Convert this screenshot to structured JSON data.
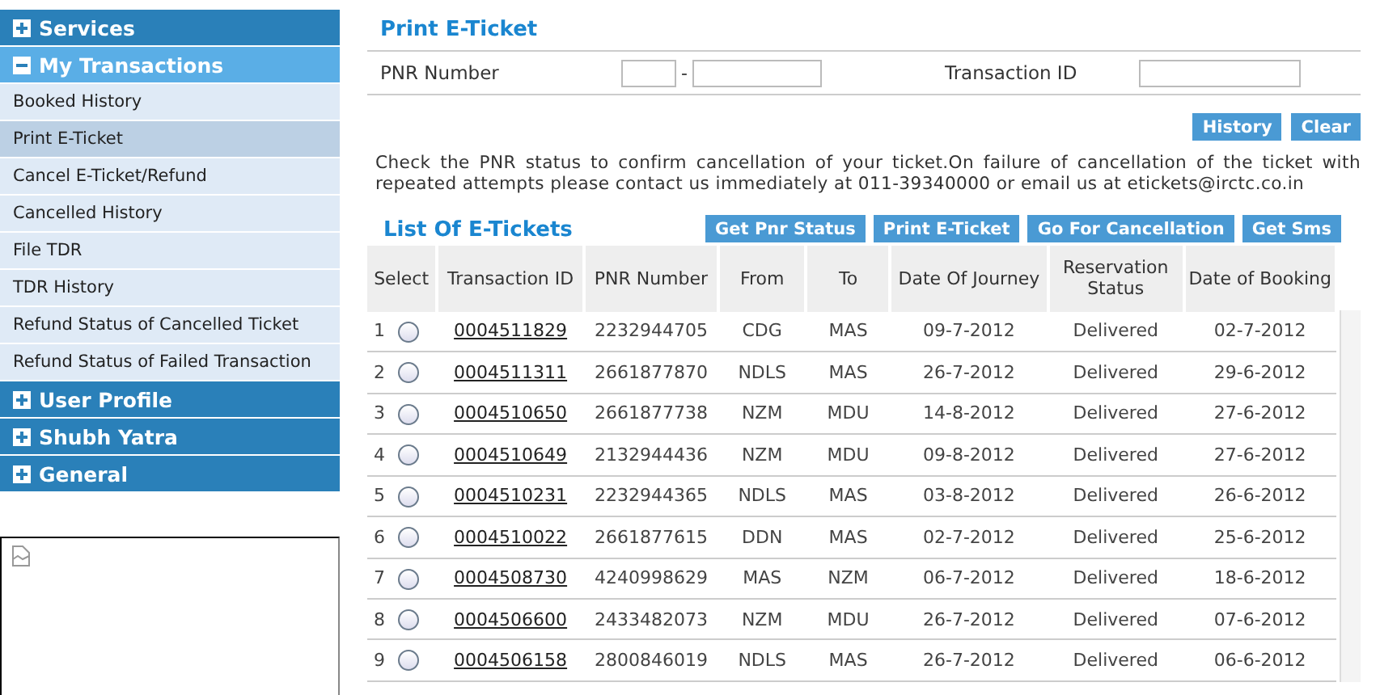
{
  "sidebar": {
    "sections": [
      {
        "label": "Services",
        "expanded": false
      },
      {
        "label": "My Transactions",
        "expanded": true,
        "items": [
          {
            "label": "Booked History",
            "selected": false
          },
          {
            "label": "Print E-Ticket",
            "selected": true
          },
          {
            "label": "Cancel E-Ticket/Refund",
            "selected": false
          },
          {
            "label": "Cancelled History",
            "selected": false
          },
          {
            "label": "File TDR",
            "selected": false
          },
          {
            "label": "TDR History",
            "selected": false
          },
          {
            "label": "Refund Status of Cancelled Ticket",
            "selected": false
          },
          {
            "label": "Refund Status of Failed Transaction",
            "selected": false
          }
        ]
      },
      {
        "label": "User Profile",
        "expanded": false
      },
      {
        "label": "Shubh Yatra",
        "expanded": false
      },
      {
        "label": "General",
        "expanded": false
      }
    ]
  },
  "form": {
    "title": "Print E-Ticket",
    "pnr_label": "PNR Number",
    "separator": "-",
    "transaction_label": "Transaction ID",
    "buttons": [
      "History",
      "Clear"
    ],
    "notice": "Check the PNR status to confirm cancellation of your ticket.On failure of cancellation of the ticket with repeated attempts please contact us immediately at 011-39340000 or email us at etickets@irctc.co.in"
  },
  "list": {
    "title": "List Of E-Tickets",
    "buttons": [
      "Get Pnr Status",
      "Print E-Ticket",
      "Go For Cancellation",
      "Get Sms"
    ],
    "columns": [
      "Select",
      "Transaction ID",
      "PNR Number",
      "From",
      "To",
      "Date Of Journey",
      "Reservation Status",
      "Date of Booking"
    ],
    "rows": [
      {
        "index": "1",
        "selected": false,
        "transaction_id": "0004511829",
        "pnr": "2232944705",
        "from": "CDG",
        "to": "MAS",
        "journey": "09-7-2012",
        "status": "Delivered",
        "booking": "02-7-2012"
      },
      {
        "index": "2",
        "selected": false,
        "transaction_id": "0004511311",
        "pnr": "2661877870",
        "from": "NDLS",
        "to": "MAS",
        "journey": "26-7-2012",
        "status": "Delivered",
        "booking": "29-6-2012"
      },
      {
        "index": "3",
        "selected": false,
        "transaction_id": "0004510650",
        "pnr": "2661877738",
        "from": "NZM",
        "to": "MDU",
        "journey": "14-8-2012",
        "status": "Delivered",
        "booking": "27-6-2012"
      },
      {
        "index": "4",
        "selected": false,
        "transaction_id": "0004510649",
        "pnr": "2132944436",
        "from": "NZM",
        "to": "MDU",
        "journey": "09-8-2012",
        "status": "Delivered",
        "booking": "27-6-2012"
      },
      {
        "index": "5",
        "selected": false,
        "transaction_id": "0004510231",
        "pnr": "2232944365",
        "from": "NDLS",
        "to": "MAS",
        "journey": "03-8-2012",
        "status": "Delivered",
        "booking": "26-6-2012"
      },
      {
        "index": "6",
        "selected": false,
        "transaction_id": "0004510022",
        "pnr": "2661877615",
        "from": "DDN",
        "to": "MAS",
        "journey": "02-7-2012",
        "status": "Delivered",
        "booking": "25-6-2012"
      },
      {
        "index": "7",
        "selected": false,
        "transaction_id": "0004508730",
        "pnr": "4240998629",
        "from": "MAS",
        "to": "NZM",
        "journey": "06-7-2012",
        "status": "Delivered",
        "booking": "18-6-2012"
      },
      {
        "index": "8",
        "selected": false,
        "transaction_id": "0004506600",
        "pnr": "2433482073",
        "from": "NZM",
        "to": "MDU",
        "journey": "26-7-2012",
        "status": "Delivered",
        "booking": "07-6-2012"
      },
      {
        "index": "9",
        "selected": false,
        "transaction_id": "0004506158",
        "pnr": "2800846019",
        "from": "NDLS",
        "to": "MAS",
        "journey": "26-7-2012",
        "status": "Delivered",
        "booking": "06-6-2012"
      }
    ]
  }
}
